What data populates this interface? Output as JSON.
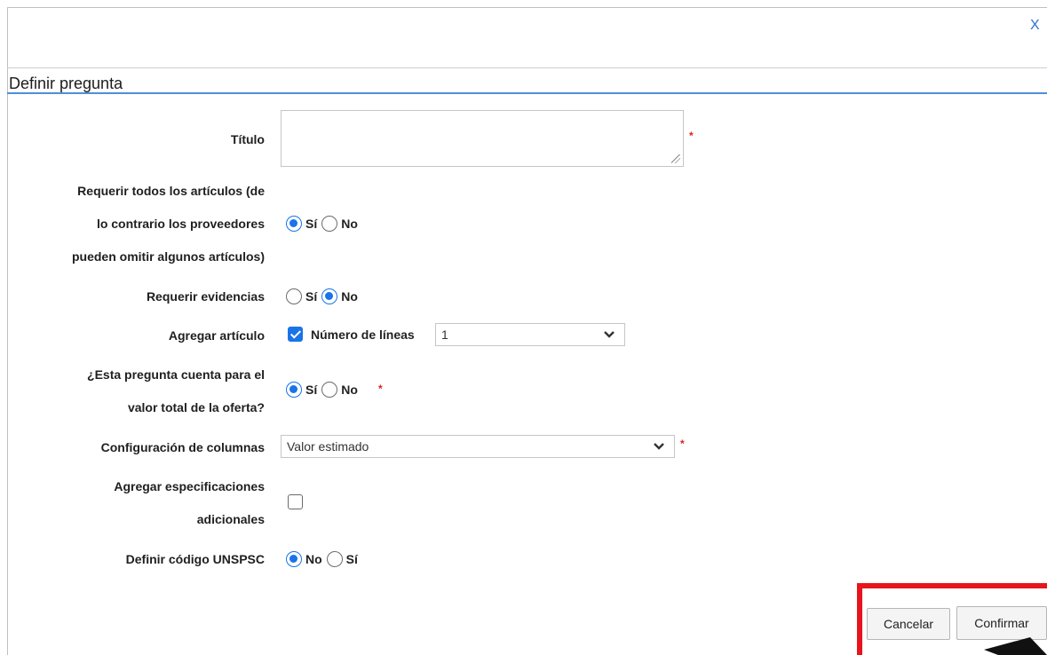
{
  "dialog": {
    "title": "Definir pregunta",
    "close_label": "X"
  },
  "form": {
    "titulo": {
      "label": "Título",
      "value": ""
    },
    "requerir_todos": {
      "label_lines": [
        "Requerir todos los artículos (de",
        "lo contrario los proveedores",
        "pueden omitir algunos artículos)"
      ],
      "options": [
        "Sí",
        "No"
      ],
      "selected": "Sí"
    },
    "requerir_evidencias": {
      "label": "Requerir evidencias",
      "options": [
        "Sí",
        "No"
      ],
      "selected": "No"
    },
    "agregar_articulo": {
      "label": "Agregar artículo",
      "checked": true,
      "checkbox_label": "Número de líneas",
      "lines_value": "1"
    },
    "cuenta_valor_total": {
      "label_lines": [
        "¿Esta pregunta cuenta para el",
        "valor total de la oferta?"
      ],
      "options": [
        "Sí",
        "No"
      ],
      "selected": "Sí"
    },
    "configuracion_columnas": {
      "label": "Configuración de columnas",
      "value": "Valor estimado"
    },
    "especificaciones_adicionales": {
      "label_lines": [
        "Agregar especificaciones",
        "adicionales"
      ],
      "checked": false
    },
    "codigo_unspsc": {
      "label": "Definir código UNSPSC",
      "options": [
        "No",
        "Sí"
      ],
      "selected": "No"
    },
    "required_marker": "*"
  },
  "actions": {
    "cancel_label": "Cancelar",
    "confirm_label": "Confirmar"
  },
  "colors": {
    "accent": "#1a73e8",
    "title_rule": "#4f8fd6",
    "required": "#e02020",
    "highlight": "#e8141b"
  }
}
